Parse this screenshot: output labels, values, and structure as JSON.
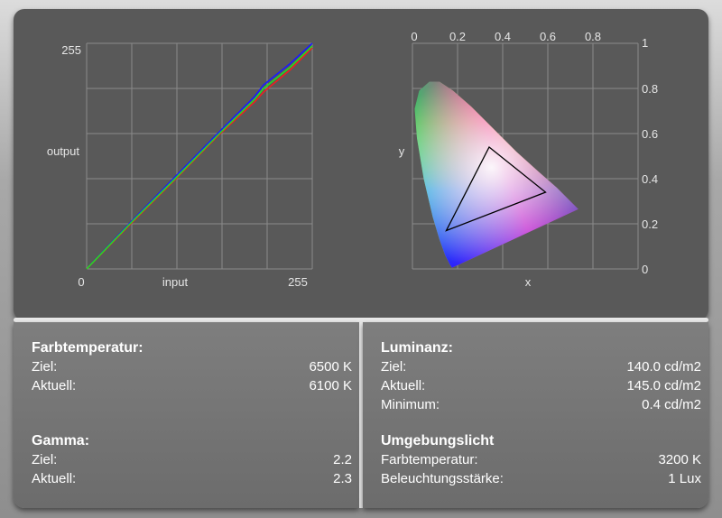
{
  "chart_data": [
    {
      "type": "line",
      "title": "",
      "xlabel": "input",
      "ylabel": "output",
      "xlim": [
        0,
        255
      ],
      "ylim": [
        0,
        255
      ],
      "x_tick_labels": [
        "0",
        "255"
      ],
      "y_tick_labels": [
        "255"
      ],
      "grid": true,
      "series": [
        {
          "color": "#1a1aff",
          "x": [
            0,
            50,
            100,
            150,
            190,
            200,
            230,
            255
          ],
          "y": [
            0,
            53,
            104,
            155,
            195,
            208,
            232,
            255
          ]
        },
        {
          "color": "#ee2020",
          "x": [
            0,
            50,
            100,
            150,
            190,
            200,
            230,
            255
          ],
          "y": [
            0,
            51,
            101,
            152,
            189,
            200,
            225,
            250
          ]
        },
        {
          "color": "#22dd22",
          "x": [
            0,
            50,
            100,
            150,
            190,
            200,
            230,
            255
          ],
          "y": [
            0,
            52,
            102,
            153,
            192,
            204,
            228,
            252
          ]
        }
      ]
    },
    {
      "type": "scatter",
      "title": "",
      "xlabel": "x",
      "ylabel": "y",
      "xlim": [
        0,
        1
      ],
      "ylim": [
        0,
        1
      ],
      "x_tick_labels": [
        "0",
        "0.2",
        "0.4",
        "0.6",
        "0.8",
        "1"
      ],
      "y_tick_labels": [
        "0",
        "0.2",
        "0.4",
        "0.6",
        "0.8"
      ],
      "grid": true,
      "gamut_triangle": [
        [
          0.34,
          0.54
        ],
        [
          0.59,
          0.34
        ],
        [
          0.15,
          0.17
        ]
      ],
      "gamut_color": "#000000"
    }
  ],
  "farbtemperatur": {
    "title": "Farbtemperatur:",
    "ziel_label": "Ziel:",
    "ziel_value": "6500 K",
    "aktuell_label": "Aktuell:",
    "aktuell_value": "6100 K"
  },
  "gamma": {
    "title": "Gamma:",
    "ziel_label": "Ziel:",
    "ziel_value": "2.2",
    "aktuell_label": "Aktuell:",
    "aktuell_value": "2.3"
  },
  "luminanz": {
    "title": "Luminanz:",
    "ziel_label": "Ziel:",
    "ziel_value": "140.0 cd/m2",
    "aktuell_label": "Aktuell:",
    "aktuell_value": "145.0 cd/m2",
    "minimum_label": "Minimum:",
    "minimum_value": "0.4 cd/m2"
  },
  "umgebungslicht": {
    "title": "Umgebungslicht",
    "farbtemp_label": "Farbtemperatur:",
    "farbtemp_value": "3200 K",
    "beleuchtung_label": "Beleuchtungsstärke:",
    "beleuchtung_value": "1 Lux"
  }
}
